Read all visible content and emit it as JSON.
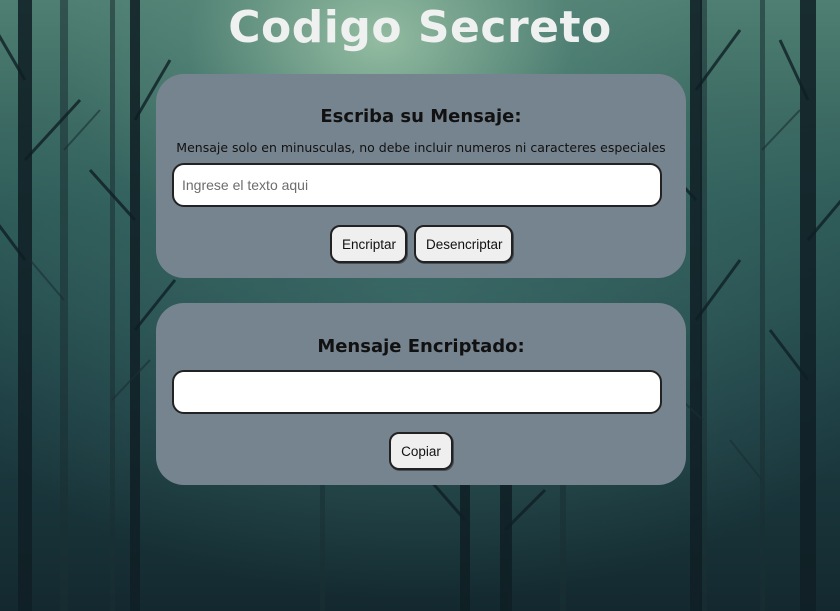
{
  "page": {
    "title": "Codigo Secreto"
  },
  "input_panel": {
    "heading": "Escriba su Mensaje:",
    "hint": "Mensaje solo en minusculas, no debe incluir numeros ni caracteres especiales",
    "text_field": {
      "value": "",
      "placeholder": "Ingrese el texto aqui"
    },
    "encrypt_label": "Encriptar",
    "decrypt_label": "Desencriptar"
  },
  "output_panel": {
    "heading": "Mensaje Encriptado:",
    "result_field": {
      "value": "",
      "placeholder": ""
    },
    "copy_label": "Copiar"
  },
  "colors": {
    "panel": "#76848f",
    "title_text": "#eef1ef",
    "button_bg": "#efefef"
  }
}
